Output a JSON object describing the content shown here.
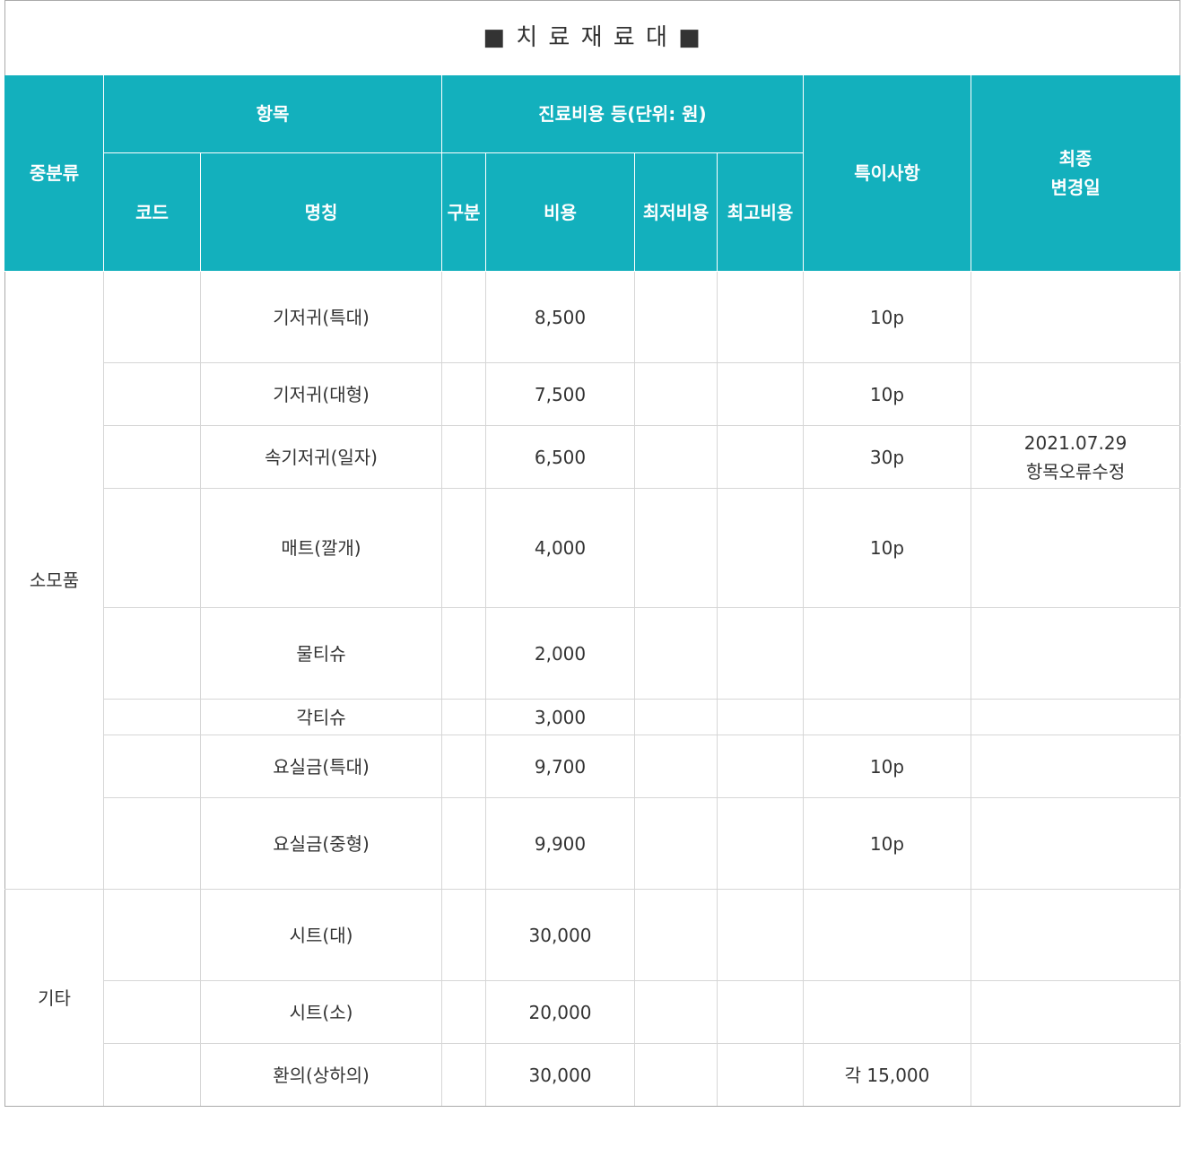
{
  "title": "■ 치 료 재 료 대 ■",
  "header": {
    "category": "중분류",
    "item_group": "항목",
    "cost_group": "진료비용 등(단위: 원)",
    "notes": "특이사항",
    "last_changed_line1": "최종",
    "last_changed_line2": "변경일",
    "code": "코드",
    "name": "명칭",
    "division": "구분",
    "cost": "비용",
    "min_cost": "최저비용",
    "max_cost": "최고비용"
  },
  "groups": [
    {
      "category": "소모품"
    },
    {
      "category": "기타"
    }
  ],
  "rows": [
    {
      "code": "",
      "name": "기저귀(특대)",
      "division": "",
      "cost": "8,500",
      "min": "",
      "max": "",
      "note": "10p",
      "changed1": "",
      "changed2": ""
    },
    {
      "code": "",
      "name": "기저귀(대형)",
      "division": "",
      "cost": "7,500",
      "min": "",
      "max": "",
      "note": "10p",
      "changed1": "",
      "changed2": ""
    },
    {
      "code": "",
      "name": "속기저귀(일자)",
      "division": "",
      "cost": "6,500",
      "min": "",
      "max": "",
      "note": "30p",
      "changed1": "2021.07.29",
      "changed2": "항목오류수정"
    },
    {
      "code": "",
      "name": "매트(깔개)",
      "division": "",
      "cost": "4,000",
      "min": "",
      "max": "",
      "note": "10p",
      "changed1": "",
      "changed2": ""
    },
    {
      "code": "",
      "name": "물티슈",
      "division": "",
      "cost": "2,000",
      "min": "",
      "max": "",
      "note": "",
      "changed1": "",
      "changed2": ""
    },
    {
      "code": "",
      "name": "각티슈",
      "division": "",
      "cost": "3,000",
      "min": "",
      "max": "",
      "note": "",
      "changed1": "",
      "changed2": ""
    },
    {
      "code": "",
      "name": "요실금(특대)",
      "division": "",
      "cost": "9,700",
      "min": "",
      "max": "",
      "note": "10p",
      "changed1": "",
      "changed2": ""
    },
    {
      "code": "",
      "name": "요실금(중형)",
      "division": "",
      "cost": "9,900",
      "min": "",
      "max": "",
      "note": "10p",
      "changed1": "",
      "changed2": ""
    },
    {
      "code": "",
      "name": "시트(대)",
      "division": "",
      "cost": "30,000",
      "min": "",
      "max": "",
      "note": "",
      "changed1": "",
      "changed2": ""
    },
    {
      "code": "",
      "name": "시트(소)",
      "division": "",
      "cost": "20,000",
      "min": "",
      "max": "",
      "note": "",
      "changed1": "",
      "changed2": ""
    },
    {
      "code": "",
      "name": "환의(상하의)",
      "division": "",
      "cost": "30,000",
      "min": "",
      "max": "",
      "note": "각 15,000",
      "changed1": "",
      "changed2": ""
    }
  ],
  "colors": {
    "header_bg": "#13b0bd",
    "header_text": "#ffffff",
    "body_text": "#333333",
    "grid": "#d6d6d6"
  }
}
